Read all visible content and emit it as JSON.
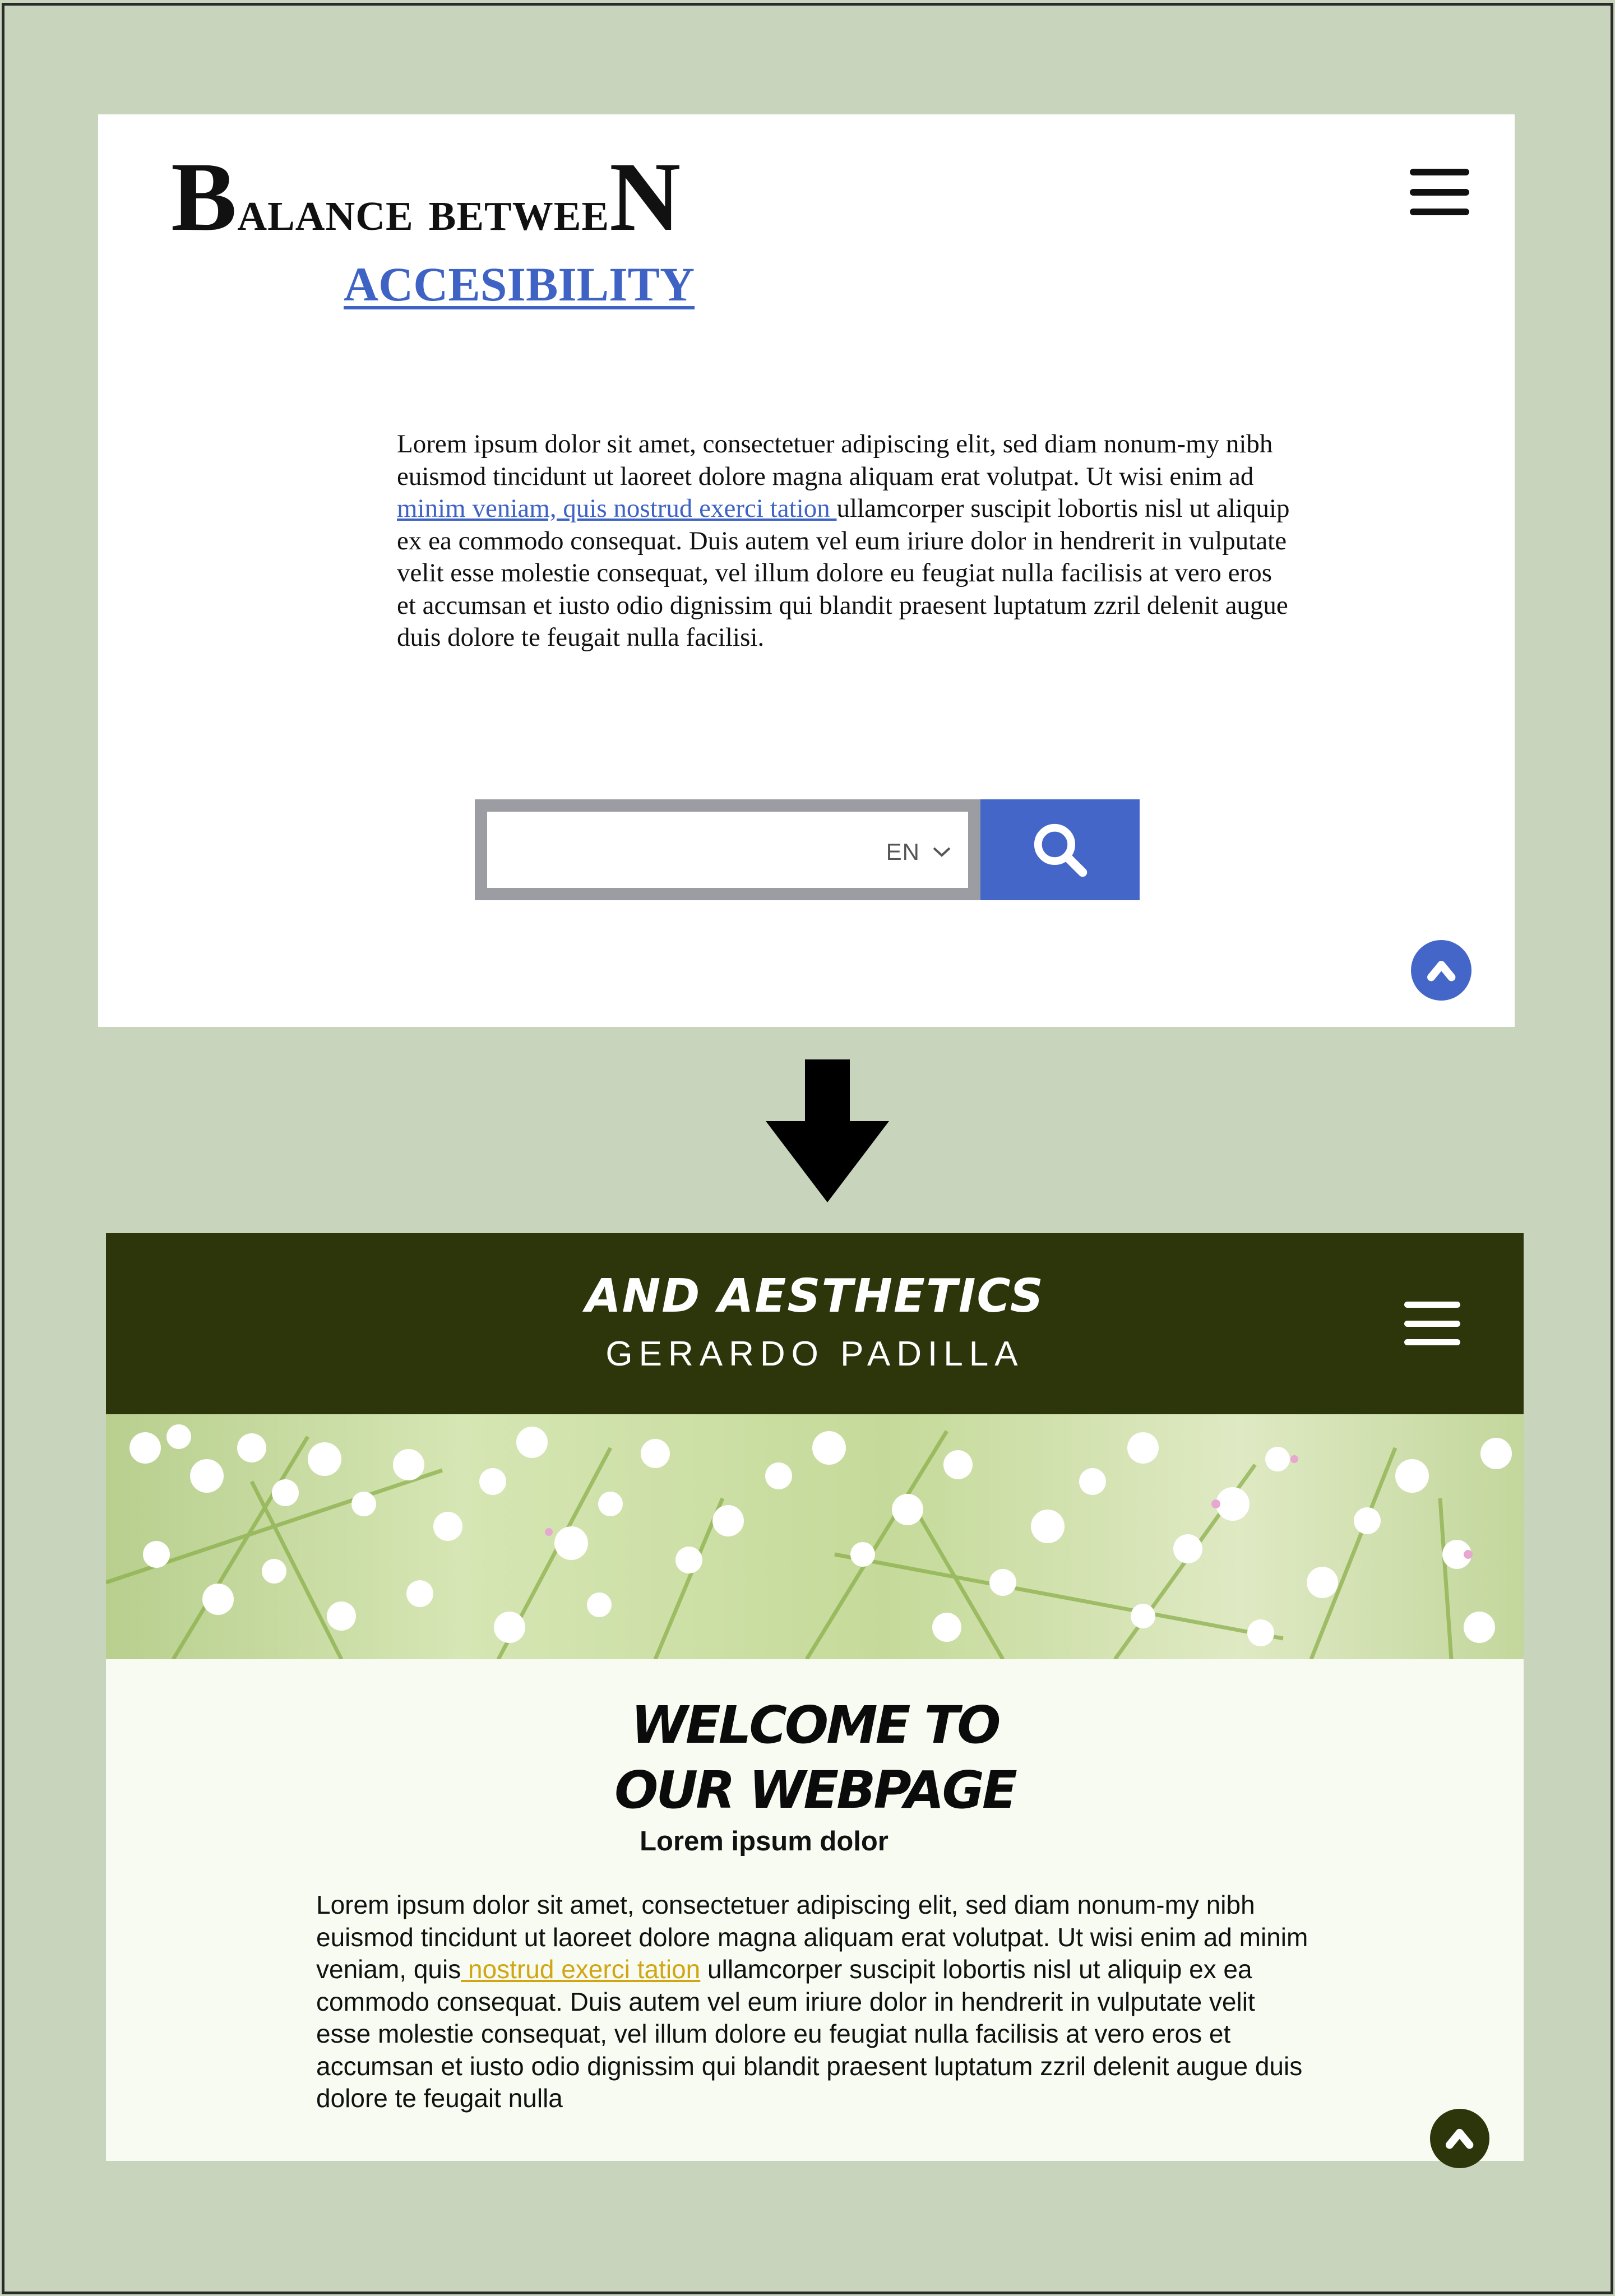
{
  "colors": {
    "page_bg": "#c9d4bd",
    "accessible_accent": "#4466c9",
    "aesthetic_dark": "#2d350b",
    "aesthetic_link": "#d0a614"
  },
  "panel1": {
    "title_first_letter": "B",
    "title_middle": "alance betwee",
    "title_last_letter": "N",
    "subtitle": "ACCESIBILITY",
    "menu_icon": "hamburger-icon",
    "body": {
      "before_link": "Lorem ipsum dolor sit amet, consectetuer adipiscing elit, sed diam nonum-my nibh euismod tincidunt ut laoreet dolore magna aliquam erat volutpat. Ut wisi enim ad ",
      "link": "minim veniam, quis nostrud exerci tation ",
      "after_link": "ullamcorper suscipit lobortis nisl ut aliquip ex ea commodo consequat. Duis autem vel eum iriure dolor in hendrerit in vulputate velit esse molestie consequat, vel illum dolore eu feugiat nulla facilisis at vero eros et accumsan et iusto odio dignissim qui blandit praesent luptatum zzril delenit augue duis dolore te feugait nulla facilisi."
    },
    "search": {
      "value": "",
      "placeholder": "",
      "language": "EN",
      "button_icon": "search-icon"
    },
    "back_to_top_icon": "chevron-up-icon"
  },
  "arrow_icon": "down-arrow-icon",
  "panel2": {
    "header_title": "AND AESTHETICS",
    "header_author": "GERARDO PADILLA",
    "menu_icon": "hamburger-icon",
    "hero_image": "white-flowers-photo",
    "welcome_line1": "WELCOME TO",
    "welcome_line2": "OUR WEBPAGE",
    "subheading": "Lorem ipsum dolor",
    "body": {
      "before_link": "Lorem ipsum dolor sit amet, consectetuer adipiscing elit, sed diam nonum-my nibh euismod tincidunt ut laoreet dolore magna aliquam erat volutpat. Ut wisi enim ad minim veniam, quis",
      "link": " nostrud exerci tation",
      "after_link": " ullamcorper suscipit lobortis nisl ut aliquip ex ea commodo consequat. Duis autem vel eum iriure dolor in hendrerit in vulputate velit esse molestie consequat, vel illum dolore eu feugiat nulla facilisis at vero eros et accumsan et iusto odio dignissim qui blandit praesent luptatum zzril delenit augue duis dolore te feugait nulla"
    },
    "back_to_top_icon": "chevron-up-icon"
  }
}
